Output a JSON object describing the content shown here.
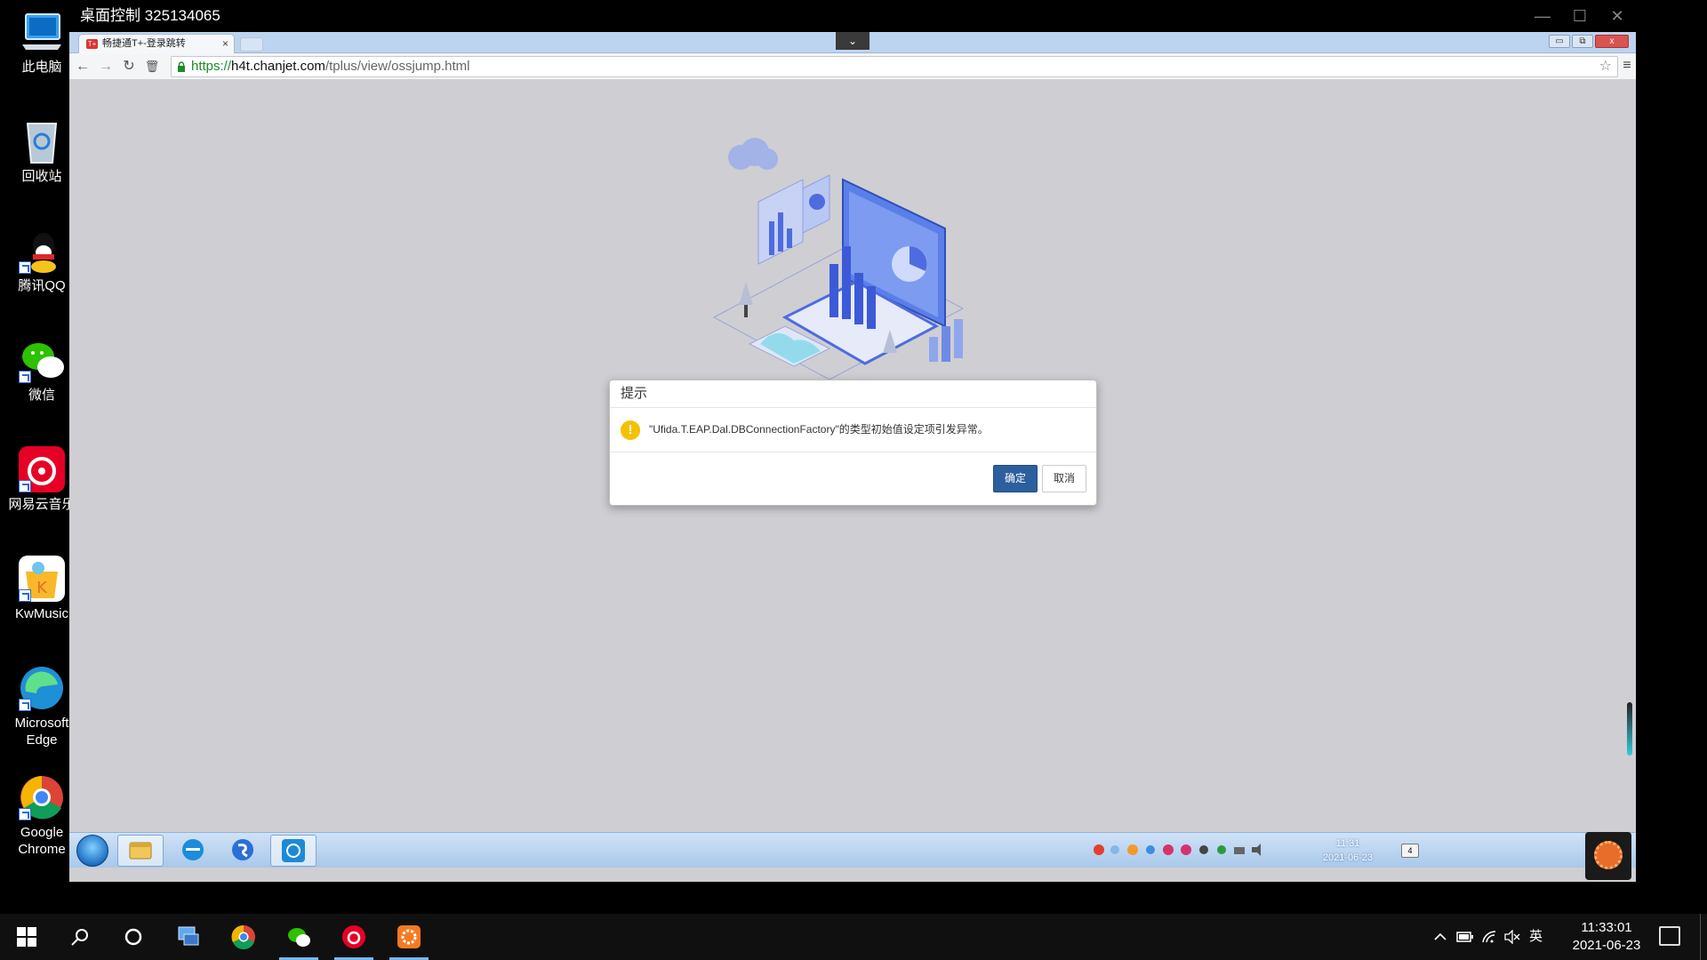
{
  "desktop": {
    "icons": [
      {
        "label": "此电脑",
        "icon": "computer-icon"
      },
      {
        "label": "回收站",
        "icon": "recycle-bin-icon"
      },
      {
        "label": "腾讯QQ",
        "icon": "qq-icon"
      },
      {
        "label": "微信",
        "icon": "wechat-icon"
      },
      {
        "label": "网易云音乐",
        "icon": "netease-music-icon"
      },
      {
        "label": "KwMusic",
        "icon": "kwmusic-icon"
      },
      {
        "label": "Microsoft Edge",
        "icon": "edge-icon"
      },
      {
        "label": "Google Chrome",
        "icon": "chrome-icon"
      }
    ]
  },
  "remote_window": {
    "title": "桌面控制 325134065",
    "controls": {
      "minimize": "—",
      "maximize": "☐",
      "close": "✕"
    }
  },
  "browser": {
    "tab": {
      "title": "畅捷通T+-登录跳转",
      "close": "×",
      "favicon": "T+"
    },
    "window_controls": {
      "minimize": "▭",
      "restore": "⧉",
      "close": "x"
    },
    "tab_dropdown": "⌄",
    "nav": {
      "back": "←",
      "forward": "→",
      "reload": "↻",
      "trash": "🗑"
    },
    "url": {
      "scheme": "https://",
      "host": "h4t.chanjet.com",
      "path": "/tplus/view/ossjump.html"
    },
    "star": "☆",
    "menu": "≡"
  },
  "dialog": {
    "title": "提示",
    "message": "\"Ufida.T.EAP.Dal.DBConnectionFactory\"的类型初始值设定项引发异常。",
    "warn_symbol": "!",
    "ok_label": "确定",
    "cancel_label": "取消",
    "colors": {
      "ok_bg": "#2c5f9e",
      "warn": "#f4c000"
    }
  },
  "remote_taskbar": {
    "time": "11:31",
    "date": "2021-06-23",
    "notif_count": "4",
    "apps": [
      "explorer-icon",
      "ie-icon",
      "sogou-browser-icon",
      "remote-app-icon"
    ]
  },
  "host_taskbar": {
    "time": "11:33:01",
    "date": "2021-06-23",
    "ime": "英",
    "apps": [
      "search-icon",
      "cortana-icon",
      "network-computer-icon",
      "chrome-icon",
      "wechat-icon",
      "netease-music-icon",
      "kwmusic-icon"
    ]
  }
}
